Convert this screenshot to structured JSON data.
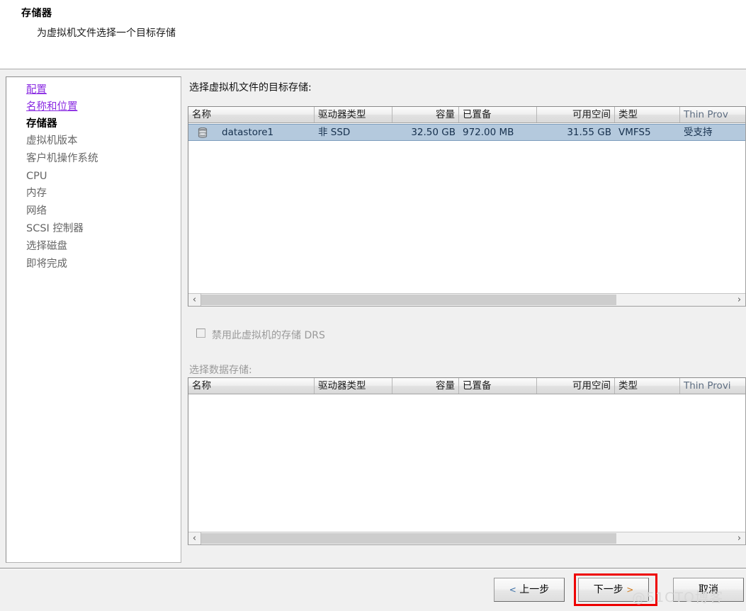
{
  "header": {
    "title": "存储器",
    "subtitle": "为虚拟机文件选择一个目标存储"
  },
  "sidebar": {
    "items": [
      {
        "label": "配置",
        "state": "link"
      },
      {
        "label": "名称和位置",
        "state": "link"
      },
      {
        "label": "存储器",
        "state": "current"
      },
      {
        "label": "虚拟机版本",
        "state": "plain"
      },
      {
        "label": "客户机操作系统",
        "state": "plain"
      },
      {
        "label": "CPU",
        "state": "plain"
      },
      {
        "label": "内存",
        "state": "plain"
      },
      {
        "label": "网络",
        "state": "plain"
      },
      {
        "label": "SCSI 控制器",
        "state": "plain"
      },
      {
        "label": "选择磁盘",
        "state": "plain"
      },
      {
        "label": "即将完成",
        "state": "plain"
      }
    ]
  },
  "content": {
    "target_store_label": "选择虚拟机文件的目标存储:",
    "select_datastore_label": "选择数据存储:",
    "drs_checkbox_label": "禁用此虚拟机的存储 DRS",
    "drs_checkbox_checked": false,
    "table1": {
      "columns": [
        "名称",
        "驱动器类型",
        "容量",
        "已置备",
        "可用空间",
        "类型",
        "Thin Prov"
      ],
      "rows": [
        {
          "icon": "datastore-icon",
          "名称": "datastore1",
          "驱动器类型": "非 SSD",
          "容量": "32.50 GB",
          "已置备": "972.00 MB",
          "可用空间": "31.55 GB",
          "类型": "VMFS5",
          "Thin Prov": "受支持",
          "selected": true
        }
      ]
    },
    "table2": {
      "columns": [
        "名称",
        "驱动器类型",
        "容量",
        "已置备",
        "可用空间",
        "类型",
        "Thin Provi"
      ],
      "rows": []
    },
    "scrollbar": {
      "left_arrow": "‹",
      "right_arrow": "›"
    }
  },
  "footer": {
    "back_label": "上一步",
    "back_arrow": "<",
    "next_label": "下一步",
    "next_arrow": ">",
    "cancel_label": "取消",
    "watermark": "@51CTO博客"
  }
}
